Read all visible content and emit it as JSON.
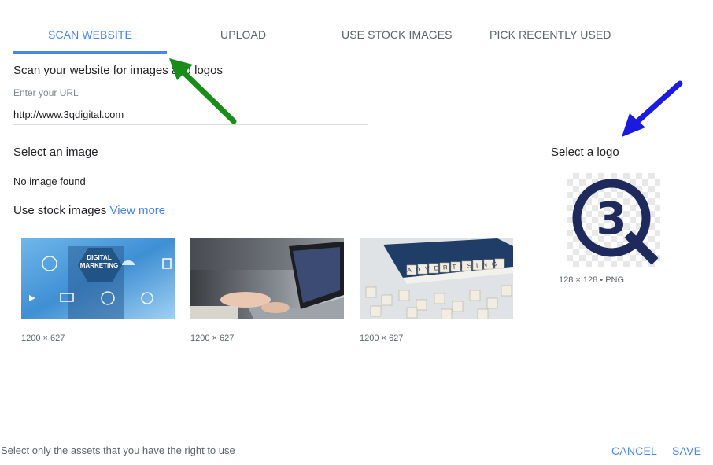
{
  "tabs": [
    {
      "label": "SCAN WEBSITE",
      "active": true
    },
    {
      "label": "UPLOAD",
      "active": false
    },
    {
      "label": "USE STOCK IMAGES",
      "active": false
    },
    {
      "label": "PICK RECENTLY USED",
      "active": false
    }
  ],
  "scan": {
    "heading": "Scan your website for images and logos",
    "url_label": "Enter your URL",
    "url_value": "http://www.3qdigital.com"
  },
  "images": {
    "heading": "Select an image",
    "empty_text": "No image found"
  },
  "stock": {
    "label": "Use stock images",
    "view_more": "View more",
    "items": [
      {
        "text": "DIGITAL MARKETING",
        "size": "1200 × 627"
      },
      {
        "size": "1200 × 627"
      },
      {
        "text": "ADVERTISING",
        "size": "1200 × 627"
      }
    ]
  },
  "logo": {
    "heading": "Select a logo",
    "meta": "128 × 128 • PNG",
    "mark": "3",
    "color": "#1f2a5c"
  },
  "footer": {
    "note": "Select only the assets that you have the right to use",
    "cancel": "CANCEL",
    "save": "SAVE"
  },
  "colors": {
    "accent": "#4a86e8",
    "green_arrow": "#1a8c1a",
    "blue_arrow": "#1a1ae0"
  }
}
